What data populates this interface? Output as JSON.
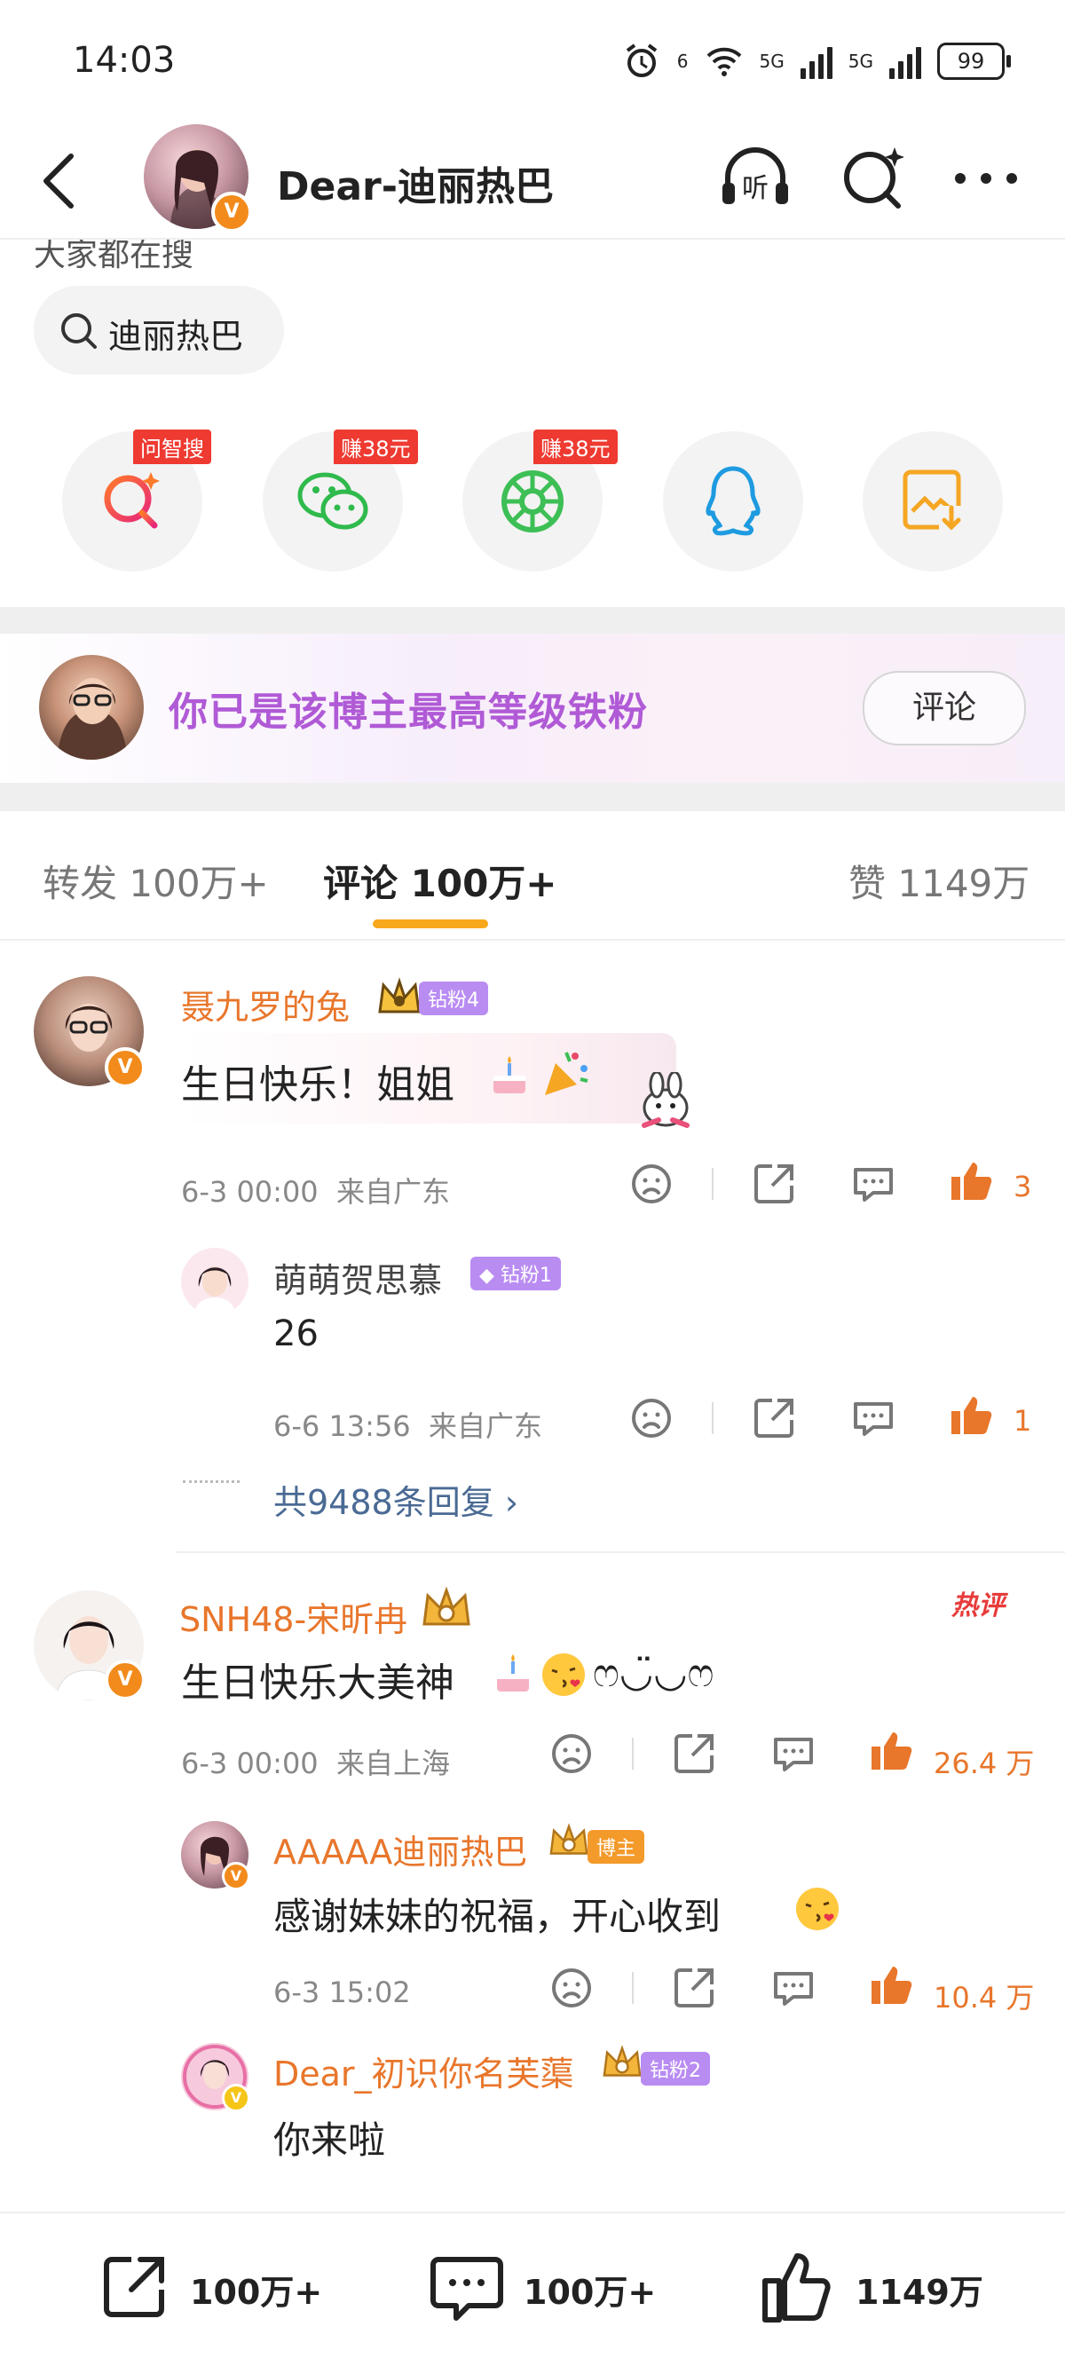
{
  "status_bar": {
    "time": "14:03",
    "net1": "6",
    "net2": "5G",
    "net3": "5G",
    "battery": "99"
  },
  "header": {
    "title": "Dear-迪丽热巴",
    "badge": "V"
  },
  "search": {
    "label": "大家都在搜",
    "term": "迪丽热巴"
  },
  "share_targets": [
    {
      "name": "wenzhisou",
      "tag": "问智搜"
    },
    {
      "name": "wechat",
      "tag": "赚38元"
    },
    {
      "name": "moments",
      "tag": "赚38元"
    },
    {
      "name": "qq",
      "tag": ""
    },
    {
      "name": "save-image",
      "tag": ""
    }
  ],
  "fan_bar": {
    "text": "你已是该博主最高等级铁粉",
    "button": "评论"
  },
  "tabs": {
    "repost_label": "转发",
    "repost_count": "100万+",
    "comment_label": "评论",
    "comment_count": "100万+",
    "like_label": "赞",
    "like_count": "1149万"
  },
  "comments": [
    {
      "user": "聂九罗的兔",
      "badge": "钻粉4",
      "text": "生日快乐！姐姐",
      "time": "6-3 00:00",
      "location": "来自广东",
      "likes": "3",
      "replies": [
        {
          "user": "萌萌贺思慕",
          "badge": "钻粉1",
          "text": "26",
          "time": "6-6 13:56",
          "location": "来自广东",
          "likes": "1"
        }
      ],
      "more_replies": "共9488条回复"
    },
    {
      "user": "SNH48-宋昕冉",
      "hot": "热评",
      "text": "生日快乐大美神",
      "text_tail": "ෆ◡̈◡ෆ",
      "time": "6-3 00:00",
      "location": "来自上海",
      "likes": "26.4 万",
      "replies": [
        {
          "user": "AAAAA迪丽热巴",
          "badge": "博主",
          "text": "感谢妹妹的祝福，开心收到",
          "time": "6-3 15:02",
          "likes": "10.4 万"
        },
        {
          "user": "Dear_初识你名芙蕖",
          "badge": "钻粉2",
          "text": "你来啦"
        }
      ]
    }
  ],
  "bottom_bar": {
    "repost": "100万+",
    "comment": "100万+",
    "like": "1149万"
  },
  "colors": {
    "accent_orange": "#e8762b",
    "tab_underline": "#f7a81b",
    "fan_purple": "#b05ad6"
  }
}
